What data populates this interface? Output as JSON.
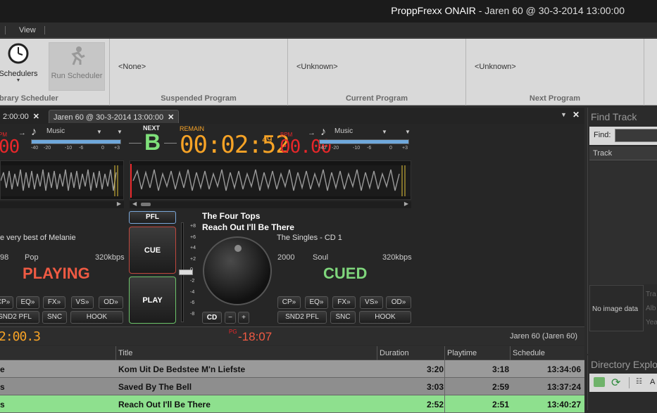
{
  "window": {
    "app_name": "ProppFrexx ONAIR",
    "title_rest": "- Jaren 60 @ 30-3-2014 13:00:00"
  },
  "menu": {
    "view_label": "View"
  },
  "ribbon": {
    "schedulers_label": "Schedulers",
    "run_scheduler_label": "Run Scheduler",
    "library_scheduler_group": "ibrary  Scheduler",
    "suspended_program_value": "<None>",
    "suspended_program_label": "Suspended Program",
    "current_program_value": "<Unknown>",
    "current_program_label": "Current Program",
    "next_program_value": "<Unknown>",
    "next_program_label": "Next Program"
  },
  "tabs": {
    "first_tab": "2:00:00",
    "active_tab": "Jaren 60 @ 30-3-2014 13:00:00"
  },
  "player": {
    "deck_a": {
      "bpm_label": "PM",
      "bpm_value": "00",
      "source_label": "Music",
      "album": "e very best of Melanie",
      "year": "98",
      "genre": "Pop",
      "bitrate": "320kbps",
      "status": "PLAYING",
      "buttons": [
        "CP»",
        "EQ»",
        "FX»",
        "VS»",
        "OD»"
      ],
      "buttons2": [
        "SND2 PFL",
        "SNC",
        "HOOK"
      ]
    },
    "next_label": "NEXT",
    "next_deck": "B",
    "remain_label": "REMAIN",
    "remain_value": "00:02:52",
    "remain_frac": "49",
    "deck_b": {
      "bpm_label": "BPM",
      "bpm_value": "00.00",
      "source_label": "Music",
      "artist": "The Four Tops",
      "title": "Reach Out I'll Be There",
      "album": "The Singles - CD 1",
      "year": "2000",
      "genre": "Soul",
      "bitrate": "320kbps",
      "status": "CUED",
      "buttons": [
        "CP»",
        "EQ»",
        "FX»",
        "VS»",
        "OD»"
      ],
      "buttons2": [
        "SND2 PFL",
        "SNC",
        "HOOK"
      ]
    },
    "meter_scale": [
      "-40",
      "-20",
      "-10",
      "-6",
      "0",
      "+3"
    ],
    "pfl_label": "PFL",
    "cue_label": "CUE",
    "play_label": "PLAY",
    "cd_label": "CD",
    "minus_label": "−",
    "plus_label": "+",
    "pitch_scale": [
      "+8",
      "+6",
      "+4",
      "+2",
      "0",
      "-2",
      "-4",
      "-6",
      "-8"
    ],
    "elapsed": "2:00.3",
    "pg_label": "PG",
    "pg_value": "-18:07",
    "program_info": "Jaren 60 (Jaren 60)"
  },
  "find_track": {
    "title": "Find Track",
    "find_label": "Find:",
    "track_col": "Track",
    "no_image": "No image data",
    "side_labels": [
      "Tra",
      "Alb",
      "Yea"
    ]
  },
  "directory_explorer": {
    "title": "Directory Explo",
    "btn_label": "A"
  },
  "playlist": {
    "columns": [
      "Title",
      "Duration",
      "Playtime",
      "Schedule"
    ],
    "rows": [
      {
        "artist_tail": "e",
        "title": "Kom Uit De Bedstee M'n Liefste",
        "duration": "3:20",
        "playtime": "3:18",
        "schedule": "13:34:06",
        "bg": "#9a9a9a"
      },
      {
        "artist_tail": "s",
        "title": "Saved By The Bell",
        "duration": "3:03",
        "playtime": "2:59",
        "schedule": "13:37:24",
        "bg": "#8e8e8e"
      },
      {
        "artist_tail": "s",
        "title": "Reach Out I'll Be There",
        "duration": "2:52",
        "playtime": "2:51",
        "schedule": "13:40:27",
        "bg": "#8ee08e"
      }
    ]
  },
  "colors": {
    "led_red": "#e8272a",
    "remain_orange": "#f7a326",
    "playing": "#ef5a43",
    "cued": "#7fd67c",
    "next_green": "#7fe07a"
  }
}
